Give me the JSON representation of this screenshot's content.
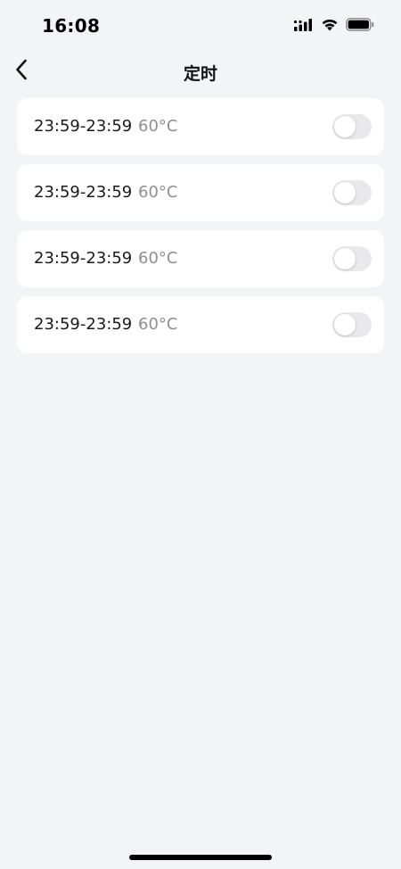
{
  "status_bar": {
    "time": "16:08",
    "icons": [
      "signal-icon",
      "wifi-icon",
      "battery-icon"
    ]
  },
  "nav": {
    "title": "定时",
    "back_icon": "chevron-left-icon"
  },
  "timers": [
    {
      "range": "23:59-23:59",
      "temp": "60°C",
      "enabled": false
    },
    {
      "range": "23:59-23:59",
      "temp": "60°C",
      "enabled": false
    },
    {
      "range": "23:59-23:59",
      "temp": "60°C",
      "enabled": false
    },
    {
      "range": "23:59-23:59",
      "temp": "60°C",
      "enabled": false
    }
  ],
  "colors": {
    "background": "#f3f4f6",
    "card": "#ffffff",
    "text_primary": "#1a1a1a",
    "text_secondary": "#8e8e93",
    "toggle_off": "#e9e9eb"
  }
}
